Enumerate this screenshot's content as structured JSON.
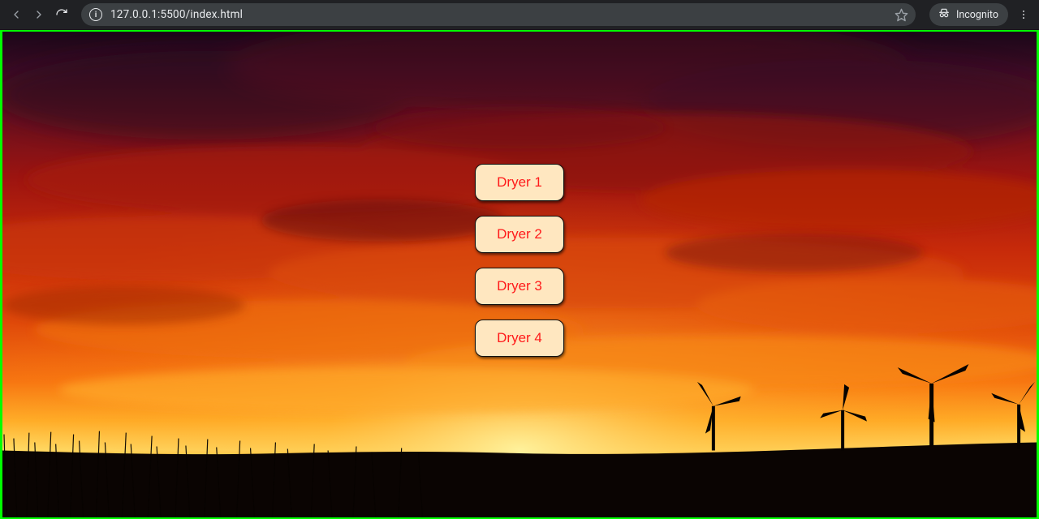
{
  "browser": {
    "url": "127.0.0.1:5500/index.html",
    "incognito_label": "Incognito"
  },
  "buttons": {
    "b0": "Dryer 1",
    "b1": "Dryer 2",
    "b2": "Dryer 3",
    "b3": "Dryer 4"
  }
}
